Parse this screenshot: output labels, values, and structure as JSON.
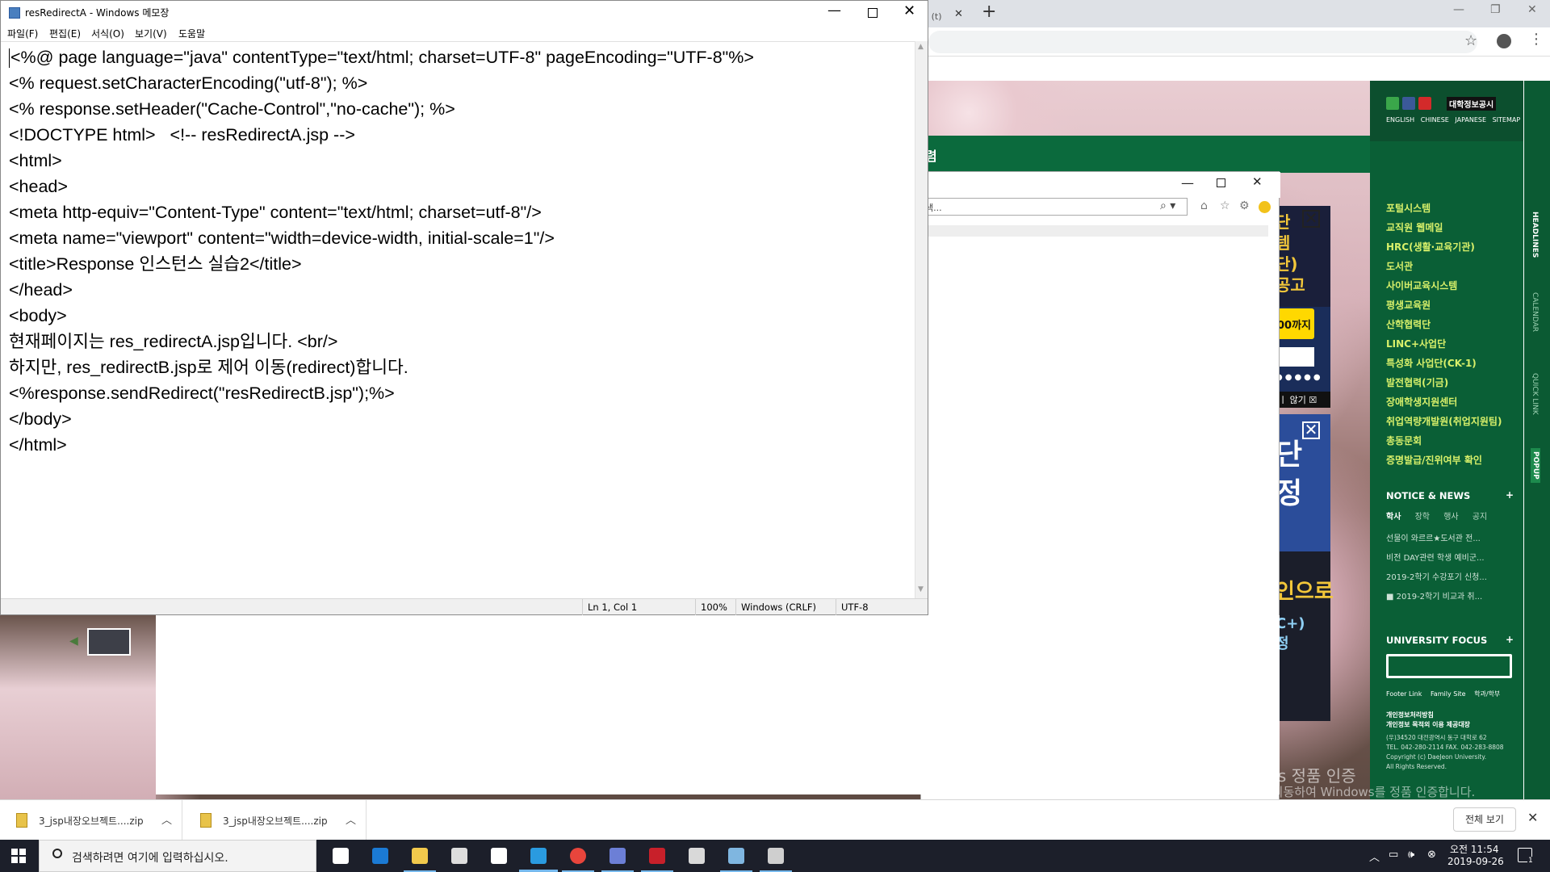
{
  "chrome": {
    "tab_fragment": "템 (t)",
    "close_glyph": "✕",
    "new_tab_glyph": "+"
  },
  "site": {
    "green_bar_text": "렴",
    "lang_links": [
      "ENGLISH",
      "CHINESE",
      "JAPANESE",
      "SITEMAP"
    ],
    "sitemap_badge": "대학정보공시",
    "quick_links": [
      "포털시스템",
      "교직원 웹메일",
      "HRC(생활·교육기관)",
      "도서관",
      "사이버교육시스템",
      "평생교육원",
      "산학협력단",
      "LINC+사업단",
      "특성화 사업단(CK-1)",
      "발전협력(기금)",
      "장애학생지원센터",
      "취업역량개발원(취업지원팀)",
      "총동문회",
      "증명발급/진위여부 확인"
    ],
    "notice_title": "NOTICE & NEWS",
    "notice_tabs": [
      "학사",
      "장학",
      "행사",
      "공지"
    ],
    "news_items": [
      "선물이 와르르★도서관 전...",
      "비전 DAY관련 학생 예비군...",
      "2019-2학기 수강포기 신청...",
      "■ 2019-2학기 비교과 취..."
    ],
    "focus_title": "UNIVERSITY FOCUS",
    "plus": "+",
    "footer_links": [
      "Footer Link",
      "Family Site",
      "학과/학부"
    ],
    "privacy_lines": [
      "개인정보처리방침",
      "개인정보 목적외 이용 제공대장"
    ],
    "address_lines": [
      "(우)34520 대전광역시 동구 대학로 62",
      "TEL. 042-280-2114   FAX. 042-283-8808",
      "Copyright (c) DaeJeon University.",
      "All Rights Reserved."
    ],
    "vertical_tabs": [
      "HEADLINES",
      "CALENDAR",
      "QUICK LINK",
      "POPUP"
    ]
  },
  "popups": {
    "a_text": "단\n템\n단)\n공고",
    "a_button": "00까지",
    "a_dots": "●●●●●",
    "a_footer": "ㅣ 않기 ☒",
    "b_text": "단\n정",
    "c_text": "인으로",
    "c_text2": "C+)\n정"
  },
  "watermark": {
    "line1": "Windows 정품 인증",
    "line2": "[설정]으로 이동하여 Windows를 정품 인증합니다."
  },
  "ie": {
    "search_placeholder": "색...",
    "search_icon": "⌕ ▾",
    "home_icon": "⌂",
    "star_icon": "☆",
    "gear_icon": "⚙"
  },
  "notepad": {
    "title": "resRedirectA - Windows 메모장",
    "menus": [
      "파일(F)",
      "편집(E)",
      "서식(O)",
      "보기(V)",
      "도움말"
    ],
    "lines": [
      "<%@ page language=\"java\" contentType=\"text/html; charset=UTF-8\" pageEncoding=\"UTF-8\"%>",
      "<% request.setCharacterEncoding(\"utf-8\"); %>",
      "<% response.setHeader(\"Cache-Control\",\"no-cache\"); %>",
      "<!DOCTYPE html>   <!-- resRedirectA.jsp -->",
      "<html>",
      "<head>",
      "<meta http-equiv=\"Content-Type\" content=\"text/html; charset=utf-8\"/>",
      "<meta name=\"viewport\" content=\"width=device-width, initial-scale=1\"/>",
      "<title>Response 인스턴스 실습2</title>",
      "</head>",
      "<body>",
      "현재페이지는 res_redirectA.jsp입니다. <br/>",
      "하지만, res_redirectB.jsp로 제어 이동(redirect)합니다.",
      "<%response.sendRedirect(\"resRedirectB.jsp\");%>",
      "</body>",
      "</html>"
    ],
    "status": {
      "position": "Ln 1, Col 1",
      "zoom": "100%",
      "line_ending": "Windows (CRLF)",
      "encoding": "UTF-8"
    }
  },
  "downloads": {
    "items": [
      "3_jsp내장오브젝트....zip",
      "3_jsp내장오브젝트....zip"
    ],
    "show_all": "전체 보기",
    "close": "✕"
  },
  "taskbar": {
    "search_text": "검색하려면 여기에 입력하십시오.",
    "clock_time": "오전 11:54",
    "clock_date": "2019-09-26",
    "notification_count": "1",
    "apps": [
      {
        "name": "task-view",
        "color": "#ffffff"
      },
      {
        "name": "edge",
        "color": "#1b7ad4"
      },
      {
        "name": "file-explorer",
        "color": "#f2c94c"
      },
      {
        "name": "store",
        "color": "#dddddd"
      },
      {
        "name": "mail",
        "color": "#ffffff"
      },
      {
        "name": "internet-explorer",
        "color": "#2a9be0"
      },
      {
        "name": "chrome",
        "color": "#e8453c"
      },
      {
        "name": "network-app",
        "color": "#6c7fd6"
      },
      {
        "name": "filezilla",
        "color": "#c8202a"
      },
      {
        "name": "photos",
        "color": "#d9d9d9"
      },
      {
        "name": "notepad",
        "color": "#7fb6e0"
      },
      {
        "name": "paint",
        "color": "#cfcfcf"
      }
    ]
  }
}
